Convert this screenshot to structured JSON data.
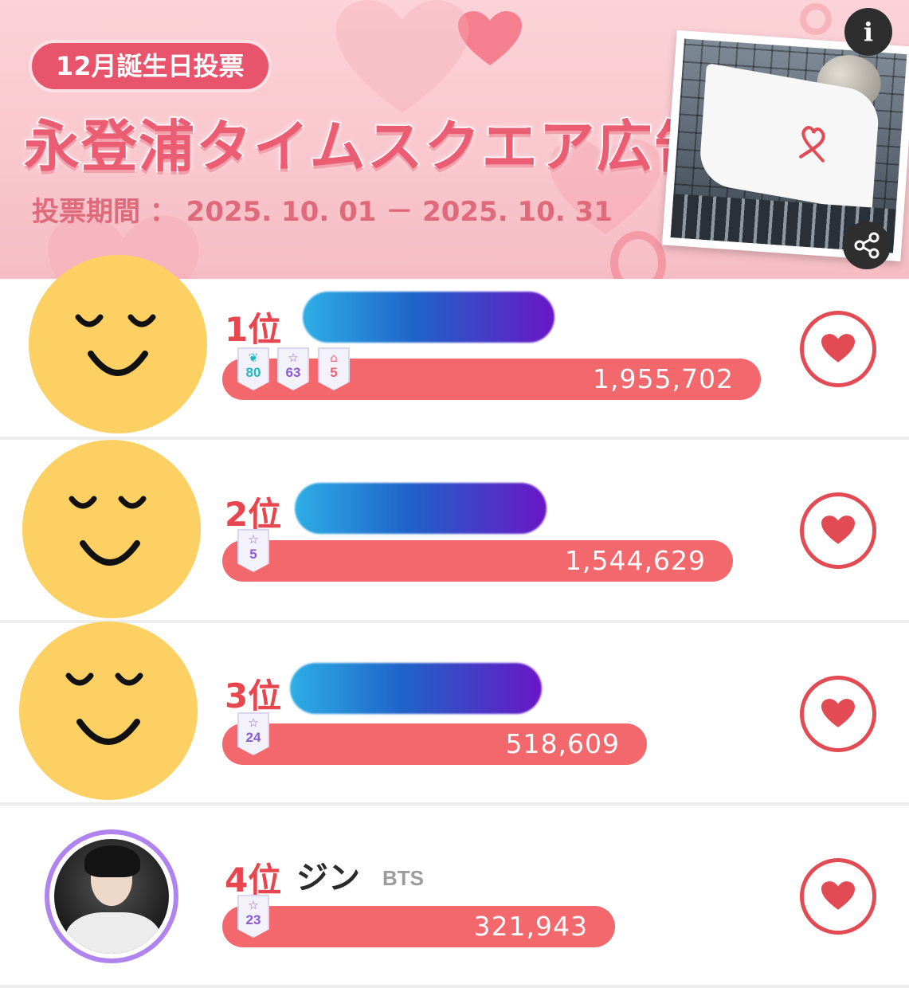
{
  "banner": {
    "pill_label": "12月誕生日投票",
    "title": "永登浦タイムスクエア広告",
    "period": "投票期間 ： 2025. 10. 01 － 2025. 10. 31",
    "info_icon": "info-icon",
    "info_glyph": "i",
    "share_icon": "share-icon"
  },
  "rankings": [
    {
      "rank_label": "1位",
      "name": "",
      "name_hidden": true,
      "group": "",
      "votes": 1955702,
      "votes_label": "1,955,702",
      "badges": [
        {
          "icon": "wing-icon",
          "glyph": "❦",
          "count": "80",
          "color": "teal"
        },
        {
          "icon": "star-icon",
          "glyph": "☆",
          "count": "63",
          "color": "purple"
        },
        {
          "icon": "cake-icon",
          "glyph": "⌂",
          "count": "5",
          "color": "red"
        }
      ]
    },
    {
      "rank_label": "2位",
      "name": "",
      "name_hidden": true,
      "group": "",
      "votes": 1544629,
      "votes_label": "1,544,629",
      "badges": [
        {
          "icon": "star-icon",
          "glyph": "☆",
          "count": "5",
          "color": "purple"
        }
      ]
    },
    {
      "rank_label": "3位",
      "name": "",
      "name_hidden": true,
      "group": "",
      "votes": 518609,
      "votes_label": "518,609",
      "badges": [
        {
          "icon": "star-icon",
          "glyph": "☆",
          "count": "24",
          "color": "purple"
        }
      ]
    },
    {
      "rank_label": "4位",
      "name": "ジン",
      "name_hidden": false,
      "group": "BTS",
      "votes": 321943,
      "votes_label": "321,943",
      "badges": [
        {
          "icon": "star-icon",
          "glyph": "☆",
          "count": "23",
          "color": "purple"
        }
      ]
    }
  ],
  "colors": {
    "accent": "#e8464f",
    "bar": "#f3686c",
    "banner_bg": "#f9c6cd",
    "avatar_yellow": "#fcd063"
  }
}
